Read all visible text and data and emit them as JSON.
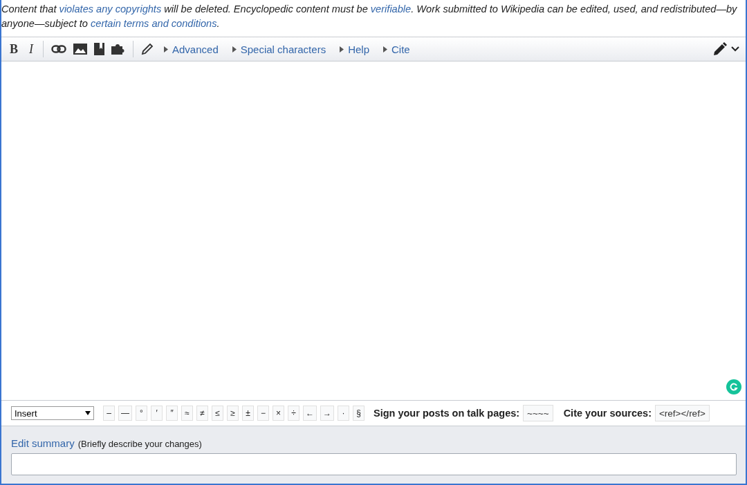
{
  "notice": [
    {
      "kind": "text",
      "text": "Content that "
    },
    {
      "kind": "link",
      "text": "violates any copyrights"
    },
    {
      "kind": "text",
      "text": " will be deleted. Encyclopedic content must be "
    },
    {
      "kind": "link",
      "text": "verifiable"
    },
    {
      "kind": "text",
      "text": ". Work submitted to Wikipedia can be edited, used, and redistributed—by anyone—subject to "
    },
    {
      "kind": "link",
      "text": "certain terms and conditions"
    },
    {
      "kind": "text",
      "text": "."
    }
  ],
  "toolbar": {
    "format_buttons": [
      "B",
      "I"
    ],
    "menus": [
      "Advanced",
      "Special characters",
      "Help",
      "Cite"
    ]
  },
  "char_bar": {
    "select": "Insert",
    "chars": [
      "–",
      "—",
      "°",
      "′",
      "″",
      "≈",
      "≠",
      "≤",
      "≥",
      "±",
      "−",
      "×",
      "÷",
      "←",
      "→",
      "·",
      "§"
    ],
    "sign_label": "Sign your posts on talk pages:",
    "sign_value": "~~~~",
    "cite_label": "Cite your sources:",
    "cite_value": "<ref></ref>"
  },
  "summary": {
    "label": "Edit summary",
    "hint": "(Briefly describe your changes)"
  }
}
